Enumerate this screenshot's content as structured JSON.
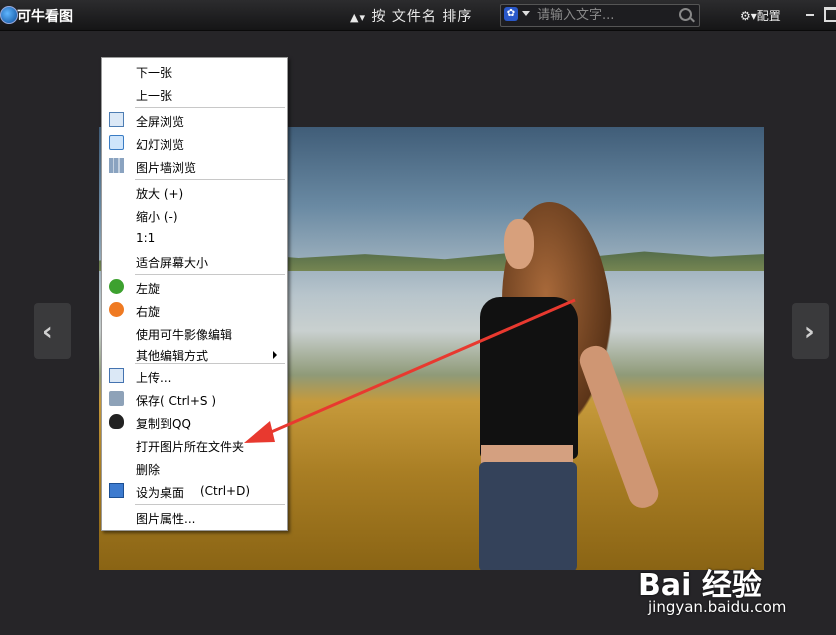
{
  "app": {
    "title": "可牛看图"
  },
  "toolbar": {
    "sort_label": "按 文件名 排序",
    "search_placeholder": "请输入文字...",
    "search_engine_icon": "baidu-paw-icon",
    "config_label": "配置"
  },
  "context_menu": {
    "items": [
      {
        "label": "下一张",
        "icon": ""
      },
      {
        "label": "上一张",
        "icon": ""
      },
      {
        "label": "全屏浏览",
        "icon": "fullscreen-icon"
      },
      {
        "label": "幻灯浏览",
        "icon": "slideshow-icon"
      },
      {
        "label": "图片墙浏览",
        "icon": "photo-wall-icon"
      },
      {
        "label": "放大 (+)",
        "icon": ""
      },
      {
        "label": "缩小 (-)",
        "icon": ""
      },
      {
        "label": "1:1",
        "icon": ""
      },
      {
        "label": "适合屏幕大小",
        "icon": ""
      },
      {
        "label": "左旋",
        "icon": "rotate-left-icon"
      },
      {
        "label": "右旋",
        "icon": "rotate-right-icon"
      },
      {
        "label": "使用可牛影像编辑",
        "icon": ""
      },
      {
        "label": "其他编辑方式",
        "icon": "submenu-arrow-icon"
      },
      {
        "label": "上传...",
        "icon": "upload-icon"
      },
      {
        "label": "保存( Ctrl+S )",
        "icon": "save-icon"
      },
      {
        "label": "复制到QQ",
        "icon": "qq-icon"
      },
      {
        "label": "打开图片所在文件夹",
        "icon": ""
      },
      {
        "label": "删除",
        "icon": ""
      },
      {
        "label": "设为桌面",
        "shortcut": "(Ctrl+D)",
        "icon": "desktop-icon"
      },
      {
        "label": "图片属性...",
        "icon": ""
      }
    ]
  },
  "nav": {
    "prev_glyph": "‹",
    "next_glyph": "›"
  },
  "watermark": {
    "logo": "Bai 经验",
    "url": "jingyan.baidu.com"
  },
  "colors": {
    "annotation_arrow": "#e8392f",
    "menu_bg": "#ffffff",
    "window_bg": "#262528"
  }
}
